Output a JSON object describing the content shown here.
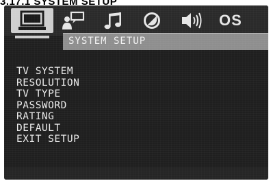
{
  "document": {
    "heading": "3.17.1 SYSTEM SETUP"
  },
  "osd": {
    "tabs": [
      {
        "icon": "monitor-icon",
        "active": true
      },
      {
        "icon": "user-speech-icon",
        "active": false
      },
      {
        "icon": "music-note-icon",
        "active": false
      },
      {
        "icon": "circle-slash-icon",
        "active": false
      },
      {
        "icon": "speaker-icon",
        "active": false
      },
      {
        "text": "OS",
        "active": false
      }
    ],
    "section_label": "SYSTEM SETUP",
    "menu_items": [
      "TV SYSTEM",
      "RESOLUTION",
      "TV TYPE",
      "PASSWORD",
      "RATING",
      "DEFAULT",
      "EXIT SETUP"
    ]
  },
  "colors": {
    "osd_background": "#1f1f1f",
    "active_tab": "#cfcfcf",
    "section_bar": "#8e8e8e",
    "menu_text": "#eaeaea"
  }
}
